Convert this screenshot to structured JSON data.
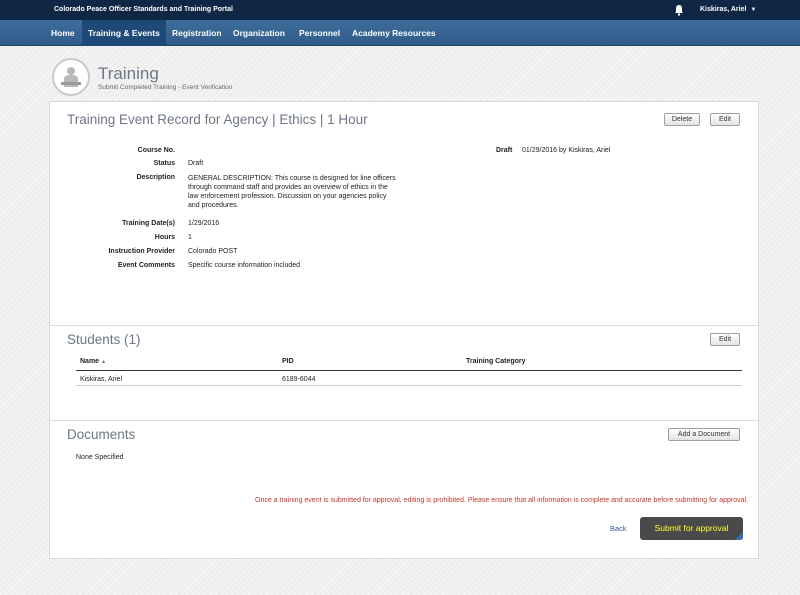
{
  "topbar": {
    "portal_title": "Colorado Peace Officer Standards and Training Portal",
    "user_name": "Kiskiras, Ariel"
  },
  "nav": {
    "items": [
      {
        "label": "Home"
      },
      {
        "label": "Training & Events"
      },
      {
        "label": "Registration"
      },
      {
        "label": "Organization"
      },
      {
        "label": "Personnel"
      },
      {
        "label": "Academy Resources"
      }
    ],
    "active_index": 1
  },
  "page_header": {
    "title": "Training",
    "subtitle": "Submit Completed Training - Event Verification"
  },
  "record": {
    "title": "Training Event Record for Agency | Ethics | 1 Hour",
    "delete_label": "Delete",
    "edit_label": "Edit",
    "fields": {
      "course_no_label": "Course No.",
      "course_no_value": "",
      "status_label": "Status",
      "status_value": "Draft",
      "description_label": "Description",
      "description_value": "GENERAL DESCRIPTION: This course is designed for line officers through command staff and provides an overview of ethics in the law enforcement profession. Discussion on your agencies policy and procedures.",
      "training_dates_label": "Training Date(s)",
      "training_dates_value": "1/29/2016",
      "hours_label": "Hours",
      "hours_value": "1",
      "provider_label": "Instruction Provider",
      "provider_value": "Colorado POST",
      "comments_label": "Event Comments",
      "comments_value": "Specific course information included"
    },
    "draft_label": "Draft",
    "draft_value": "01/29/2016 by Kiskiras, Ariel"
  },
  "students": {
    "title": "Students (1)",
    "edit_label": "Edit",
    "columns": {
      "name": "Name",
      "pid": "PID",
      "category": "Training Category"
    },
    "rows": [
      {
        "name": "Kiskiras, Ariel",
        "pid": "6189-6044",
        "category": ""
      }
    ]
  },
  "documents": {
    "title": "Documents",
    "add_label": "Add a Document",
    "empty_text": "None Specified"
  },
  "footer": {
    "warning": "Once a training event is submitted for approval, editing is prohibited. Please ensure that all information is complete and accurate before submitting for approval.",
    "back_label": "Back",
    "submit_label": "Submit for approval"
  },
  "colors": {
    "topbar": "#0f2744",
    "navbar": "#2f5c89",
    "warning": "#c0392b",
    "submit_bg": "#4a4a4a",
    "submit_text": "#ffff33"
  },
  "icons": [
    "bell-icon",
    "caret-down-icon",
    "training-logo-icon",
    "sort-asc-icon"
  ]
}
